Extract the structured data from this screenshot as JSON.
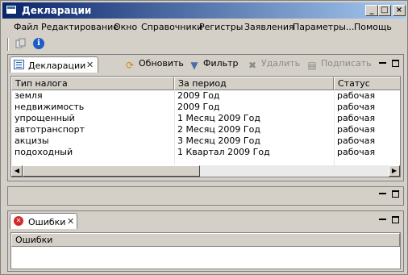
{
  "window": {
    "title": "Декларации"
  },
  "menu": [
    "Файл",
    "Редактирование",
    "Окно",
    "Справочники",
    "Регистры",
    "Заявления",
    "Параметры...",
    "Помощь"
  ],
  "main_view": {
    "tab_label": "Декларации",
    "actions": {
      "refresh": "Обновить",
      "filter": "Фильтр",
      "delete": "Удалить",
      "sign": "Подписать"
    },
    "columns": [
      "Тип налога",
      "За период",
      "Статус"
    ],
    "rows": [
      [
        "земля",
        "2009 Год",
        "рабочая"
      ],
      [
        "недвижимость",
        "2009 Год",
        "рабочая"
      ],
      [
        "упрощенный",
        "1 Месяц 2009 Год",
        "рабочая"
      ],
      [
        "автотранспорт",
        "2 Месяц 2009 Год",
        "рабочая"
      ],
      [
        "акцизы",
        "3 Месяц 2009 Год",
        "рабочая"
      ],
      [
        "подоходный",
        "1 Квартал 2009 Год",
        "рабочая"
      ]
    ]
  },
  "errors_view": {
    "tab_label": "Ошибки",
    "columns": [
      "Ошибки"
    ]
  },
  "colors": {
    "titlebar_start": "#0a246a",
    "titlebar_end": "#a6caf0",
    "face": "#d4d0c8"
  }
}
